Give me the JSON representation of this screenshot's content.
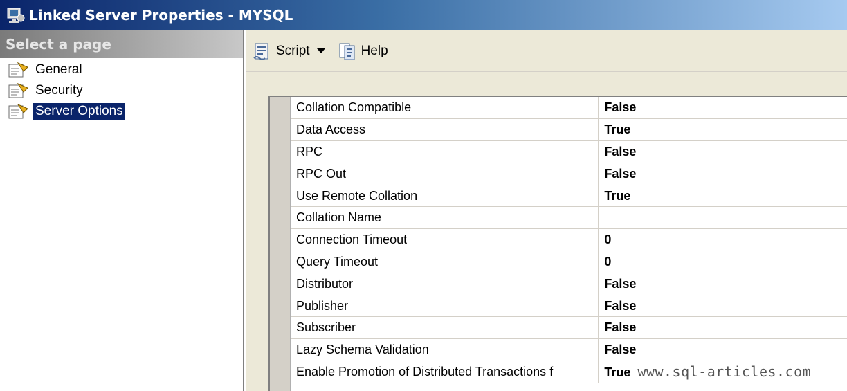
{
  "window": {
    "title": "Linked Server Properties - MYSQL"
  },
  "sidebar": {
    "header": "Select a page",
    "items": [
      {
        "label": "General",
        "selected": false
      },
      {
        "label": "Security",
        "selected": false
      },
      {
        "label": "Server Options",
        "selected": true
      }
    ]
  },
  "toolbar": {
    "script_label": "Script",
    "help_label": "Help"
  },
  "properties": [
    {
      "name": "Collation Compatible",
      "value": "False"
    },
    {
      "name": "Data Access",
      "value": "True"
    },
    {
      "name": "RPC",
      "value": "False"
    },
    {
      "name": "RPC Out",
      "value": "False"
    },
    {
      "name": "Use Remote Collation",
      "value": "True"
    },
    {
      "name": "Collation Name",
      "value": ""
    },
    {
      "name": "Connection Timeout",
      "value": "0"
    },
    {
      "name": "Query Timeout",
      "value": "0"
    },
    {
      "name": "Distributor",
      "value": "False"
    },
    {
      "name": "Publisher",
      "value": "False"
    },
    {
      "name": "Subscriber",
      "value": "False"
    },
    {
      "name": "Lazy Schema Validation",
      "value": "False"
    },
    {
      "name": "Enable Promotion of Distributed Transactions f",
      "value": "True"
    }
  ],
  "watermark": "www.sql-articles.com",
  "colors": {
    "title_gradient_start": "#0a246a",
    "title_gradient_end": "#a6caf0",
    "selection": "#0a246a",
    "pane_bg": "#ece9d8"
  },
  "icons": {
    "app": "server-properties-icon",
    "page": "page-properties-icon",
    "script": "script-icon",
    "help": "help-icon"
  }
}
